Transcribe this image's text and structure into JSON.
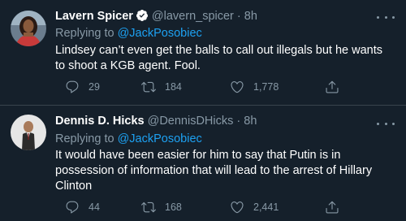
{
  "tweets": [
    {
      "display_name": "Lavern Spicer",
      "verified": true,
      "handle": "@lavern_spicer",
      "separator": "·",
      "time": "8h",
      "replying_prefix": "Replying to",
      "replying_to": "@JackPosobiec",
      "text": "Lindsey can’t even get the balls to call out illegals but he wants to shoot a KGB agent. Fool.",
      "replies": "29",
      "retweets": "184",
      "likes": "1,778"
    },
    {
      "display_name": "Dennis D. Hicks",
      "verified": false,
      "handle": "@DennisDHicks",
      "separator": "·",
      "time": "8h",
      "replying_prefix": "Replying to",
      "replying_to": "@JackPosobiec",
      "text": "It would have been easier for him to say that Putin is in possession of information that will lead to the arrest of Hillary Clinton",
      "replies": "44",
      "retweets": "168",
      "likes": "2,441"
    }
  ],
  "colors": {
    "background": "#15202b",
    "divider": "#38444d",
    "secondary_text": "#8899a6",
    "link": "#1da1f2",
    "verified_badge": "#ffffff"
  },
  "icons": [
    "verified-icon",
    "more-icon",
    "reply-icon",
    "retweet-icon",
    "like-icon",
    "share-icon"
  ]
}
